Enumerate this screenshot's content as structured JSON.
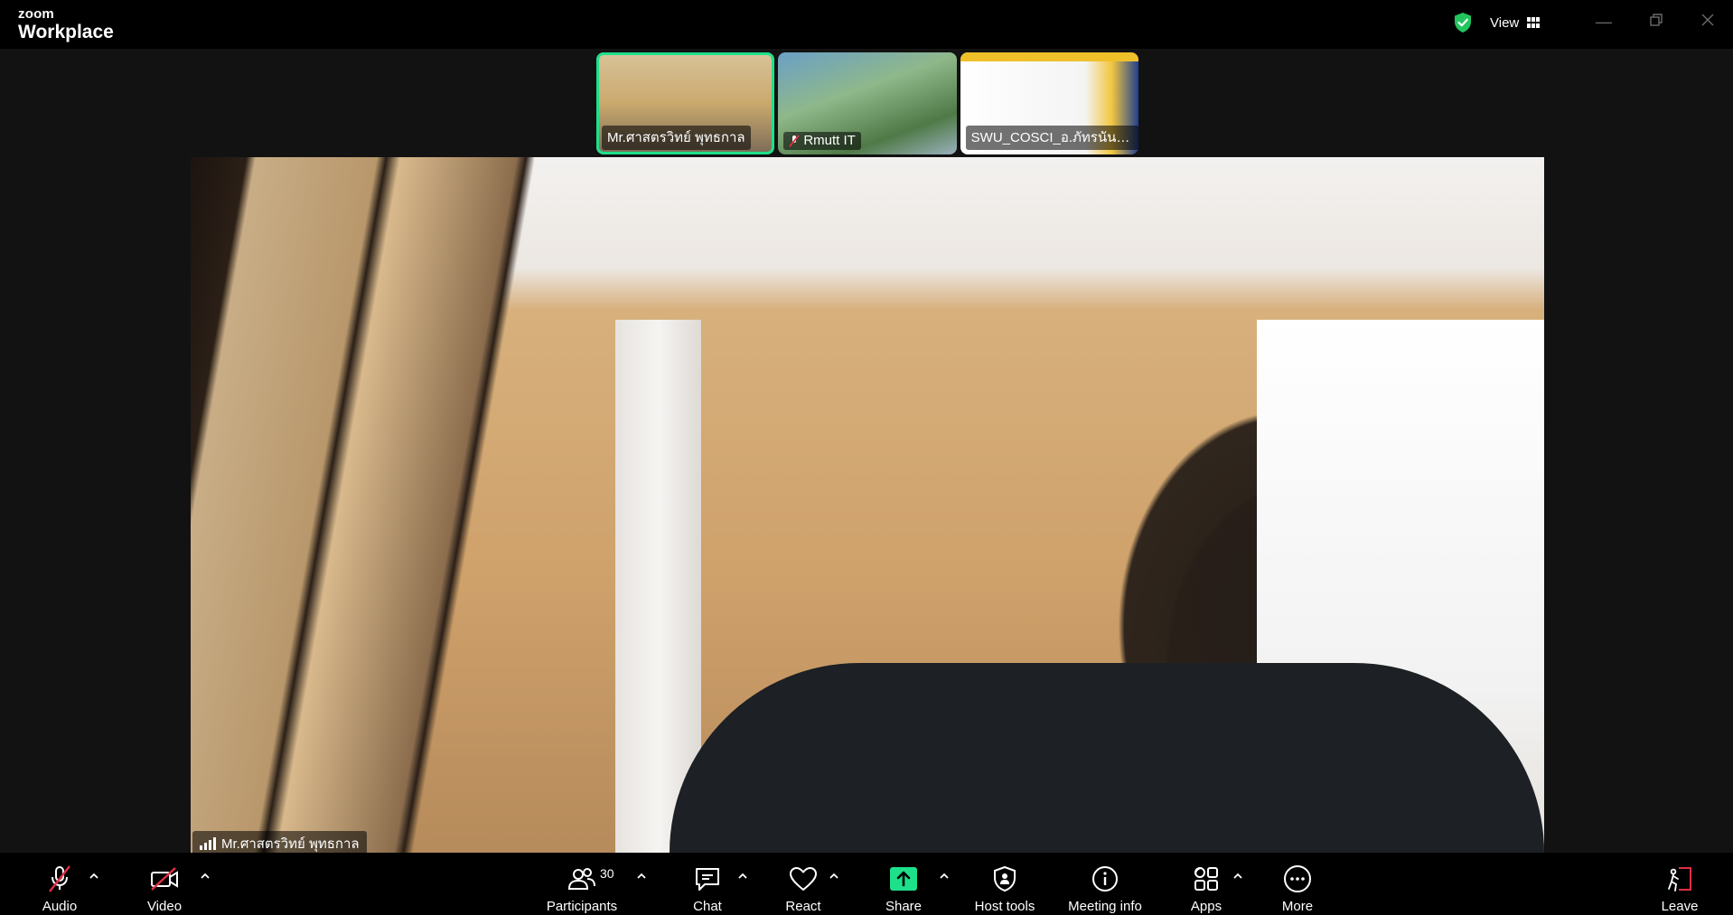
{
  "app": {
    "brand_small": "zoom",
    "brand_big": "Workplace",
    "view_label": "View"
  },
  "thumbnails": [
    {
      "name": "Mr.ศาสตรวิทย์ พุทธกาล",
      "active": true,
      "muted": false
    },
    {
      "name": "Rmutt IT",
      "active": false,
      "muted": true
    },
    {
      "name": "SWU_COSCI_อ.ภัทรนันท์ ไว...",
      "active": false,
      "muted": false
    }
  ],
  "main_speaker": {
    "name": "Mr.ศาสตรวิทย์ พุทธกาล"
  },
  "toolbar": {
    "audio_label": "Audio",
    "video_label": "Video",
    "participants_label": "Participants",
    "participants_count": "30",
    "chat_label": "Chat",
    "react_label": "React",
    "share_label": "Share",
    "host_tools_label": "Host tools",
    "meeting_info_label": "Meeting info",
    "apps_label": "Apps",
    "more_label": "More",
    "leave_label": "Leave"
  },
  "colors": {
    "active_speaker_border": "#1ee08b",
    "share_green": "#1ee08b",
    "muted_red": "#e02f44",
    "shield_green": "#22c55e"
  },
  "icons": {
    "audio": "microphone-muted-icon",
    "video": "camera-off-icon",
    "participants": "people-icon",
    "chat": "chat-bubble-icon",
    "react": "heart-icon",
    "share": "share-arrow-icon",
    "host_tools": "shield-icon",
    "meeting_info": "info-icon",
    "apps": "apps-icon",
    "more": "ellipsis-icon",
    "leave": "leave-door-icon"
  }
}
